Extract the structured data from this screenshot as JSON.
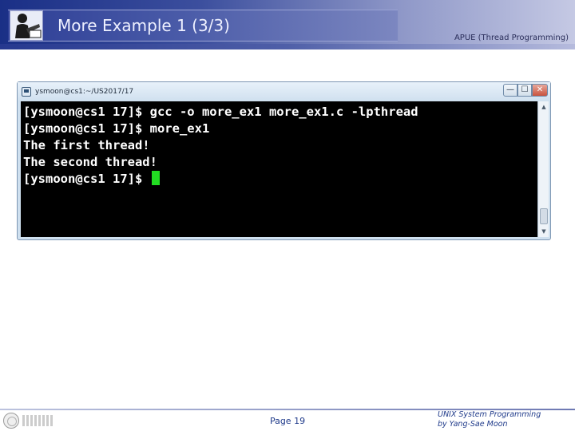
{
  "header": {
    "title": "More Example 1 (3/3)",
    "course": "APUE (Thread Programming)",
    "logo_icon": "presenter-icon"
  },
  "window": {
    "title": "ysmoon@cs1:~/US2017/17",
    "controls": {
      "minimize": "—",
      "maximize": "☐",
      "close": "✕"
    },
    "icon": "putty-terminal-icon"
  },
  "terminal": {
    "lines": [
      "[ysmoon@cs1 17]$ gcc -o more_ex1 more_ex1.c -lpthread",
      "[ysmoon@cs1 17]$ more_ex1",
      "The first thread!",
      "The second thread!",
      "[ysmoon@cs1 17]$ "
    ],
    "cursor_color": "#22dd22"
  },
  "footer": {
    "page": "Page 19",
    "credit_line1": "UNIX System Programming",
    "credit_line2": "by Yang-Sae Moon"
  },
  "colors": {
    "header_dark": "#1a2f86",
    "header_light": "#c5c9e4",
    "accent_text": "#1f3a8a",
    "terminal_bg": "#000000"
  }
}
